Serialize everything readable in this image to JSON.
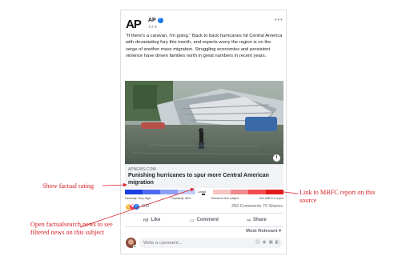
{
  "post": {
    "page_name": "AP",
    "logo_text": "AP",
    "timestamp": "1d",
    "text": "\"If there's a caravan, I'm going.\" Back to back hurricanes hit Central America with devastating fury this month, and experts worry the region is on the verge of another mass migration. Struggling economies and persistent violence have driven families north in great numbers in recent years.",
    "link_domain": "APNEWS.COM",
    "link_title": "Punishing hurricanes to spur more Central American migration"
  },
  "rating": {
    "bias_label": "Least",
    "bias_colors": [
      "#1a3fe0",
      "#4d6bf0",
      "#8ba0f5",
      "#c4cdf7",
      "#ffffff",
      "#f7c4c4",
      "#f08b8b",
      "#f04d4d",
      "#e01a1a"
    ],
    "factual": "Factually: Very High",
    "popularity": "Popularity: 88%",
    "research": "Research this subject",
    "mbfc": "See MBFC's report"
  },
  "stats": {
    "reactions": "609",
    "comments": "250 Comments",
    "shares": "79 Shares"
  },
  "actions": {
    "like": "Like",
    "comment": "Comment",
    "share": "Share"
  },
  "comments": {
    "sort": "Most Relevant",
    "placeholder": "Write a comment..."
  },
  "annotations": {
    "show_rating": "Show factual rating",
    "mbfc_link": "Link to MBFC report on this source",
    "factualsearch": "Open factualsearch.news to see filtered news on this subject"
  }
}
